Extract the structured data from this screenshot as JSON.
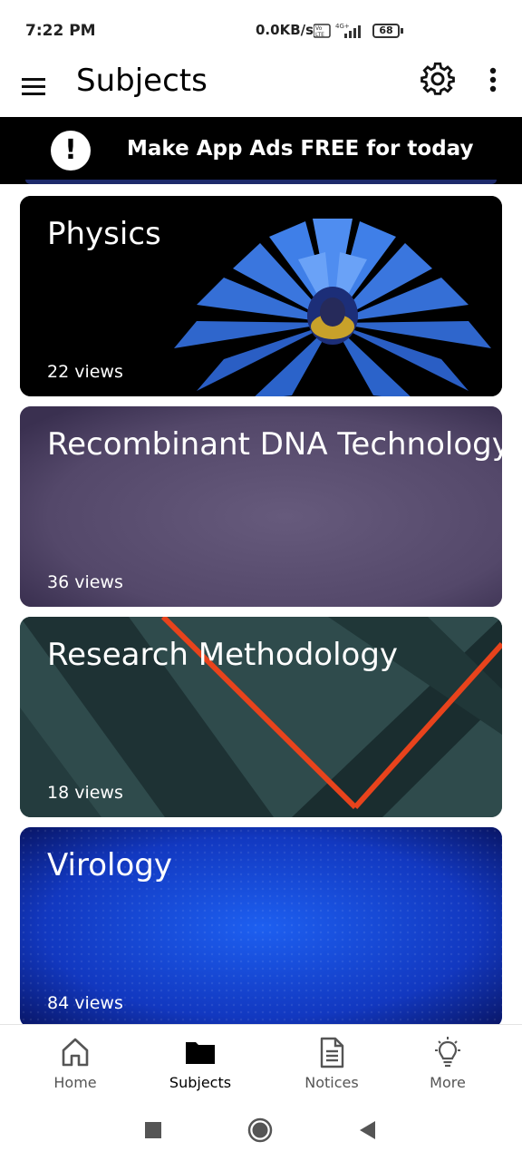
{
  "status_bar": {
    "time": "7:22 PM",
    "network_speed": "0.0KB/s",
    "battery": "68"
  },
  "app_bar": {
    "title": "Subjects",
    "menu_icon": "hamburger-menu-icon",
    "settings_icon": "gear-icon",
    "more_icon": "more-vert-icon"
  },
  "ad_banner": {
    "text": "Make App Ads FREE for today",
    "icon": "exclamation-icon"
  },
  "subjects": [
    {
      "title": "Physics",
      "views": "22 views",
      "bg_color": "#000000"
    },
    {
      "title": "Recombinant DNA Technology",
      "views": "36 views",
      "bg_color": "#5a4c6c"
    },
    {
      "title": "Research Methodology",
      "views": "18 views",
      "bg_color": "#2b4849"
    },
    {
      "title": "Virology",
      "views": "84 views",
      "bg_color": "#0f33b8"
    }
  ],
  "bottom_nav": {
    "items": [
      {
        "label": "Home",
        "icon": "home-icon",
        "active": false
      },
      {
        "label": "Subjects",
        "icon": "folder-icon",
        "active": true
      },
      {
        "label": "Notices",
        "icon": "document-icon",
        "active": false
      },
      {
        "label": "More",
        "icon": "lightbulb-icon",
        "active": false
      }
    ]
  },
  "system_nav": {
    "items": [
      "recents-square-icon",
      "home-circle-icon",
      "back-triangle-icon"
    ]
  }
}
